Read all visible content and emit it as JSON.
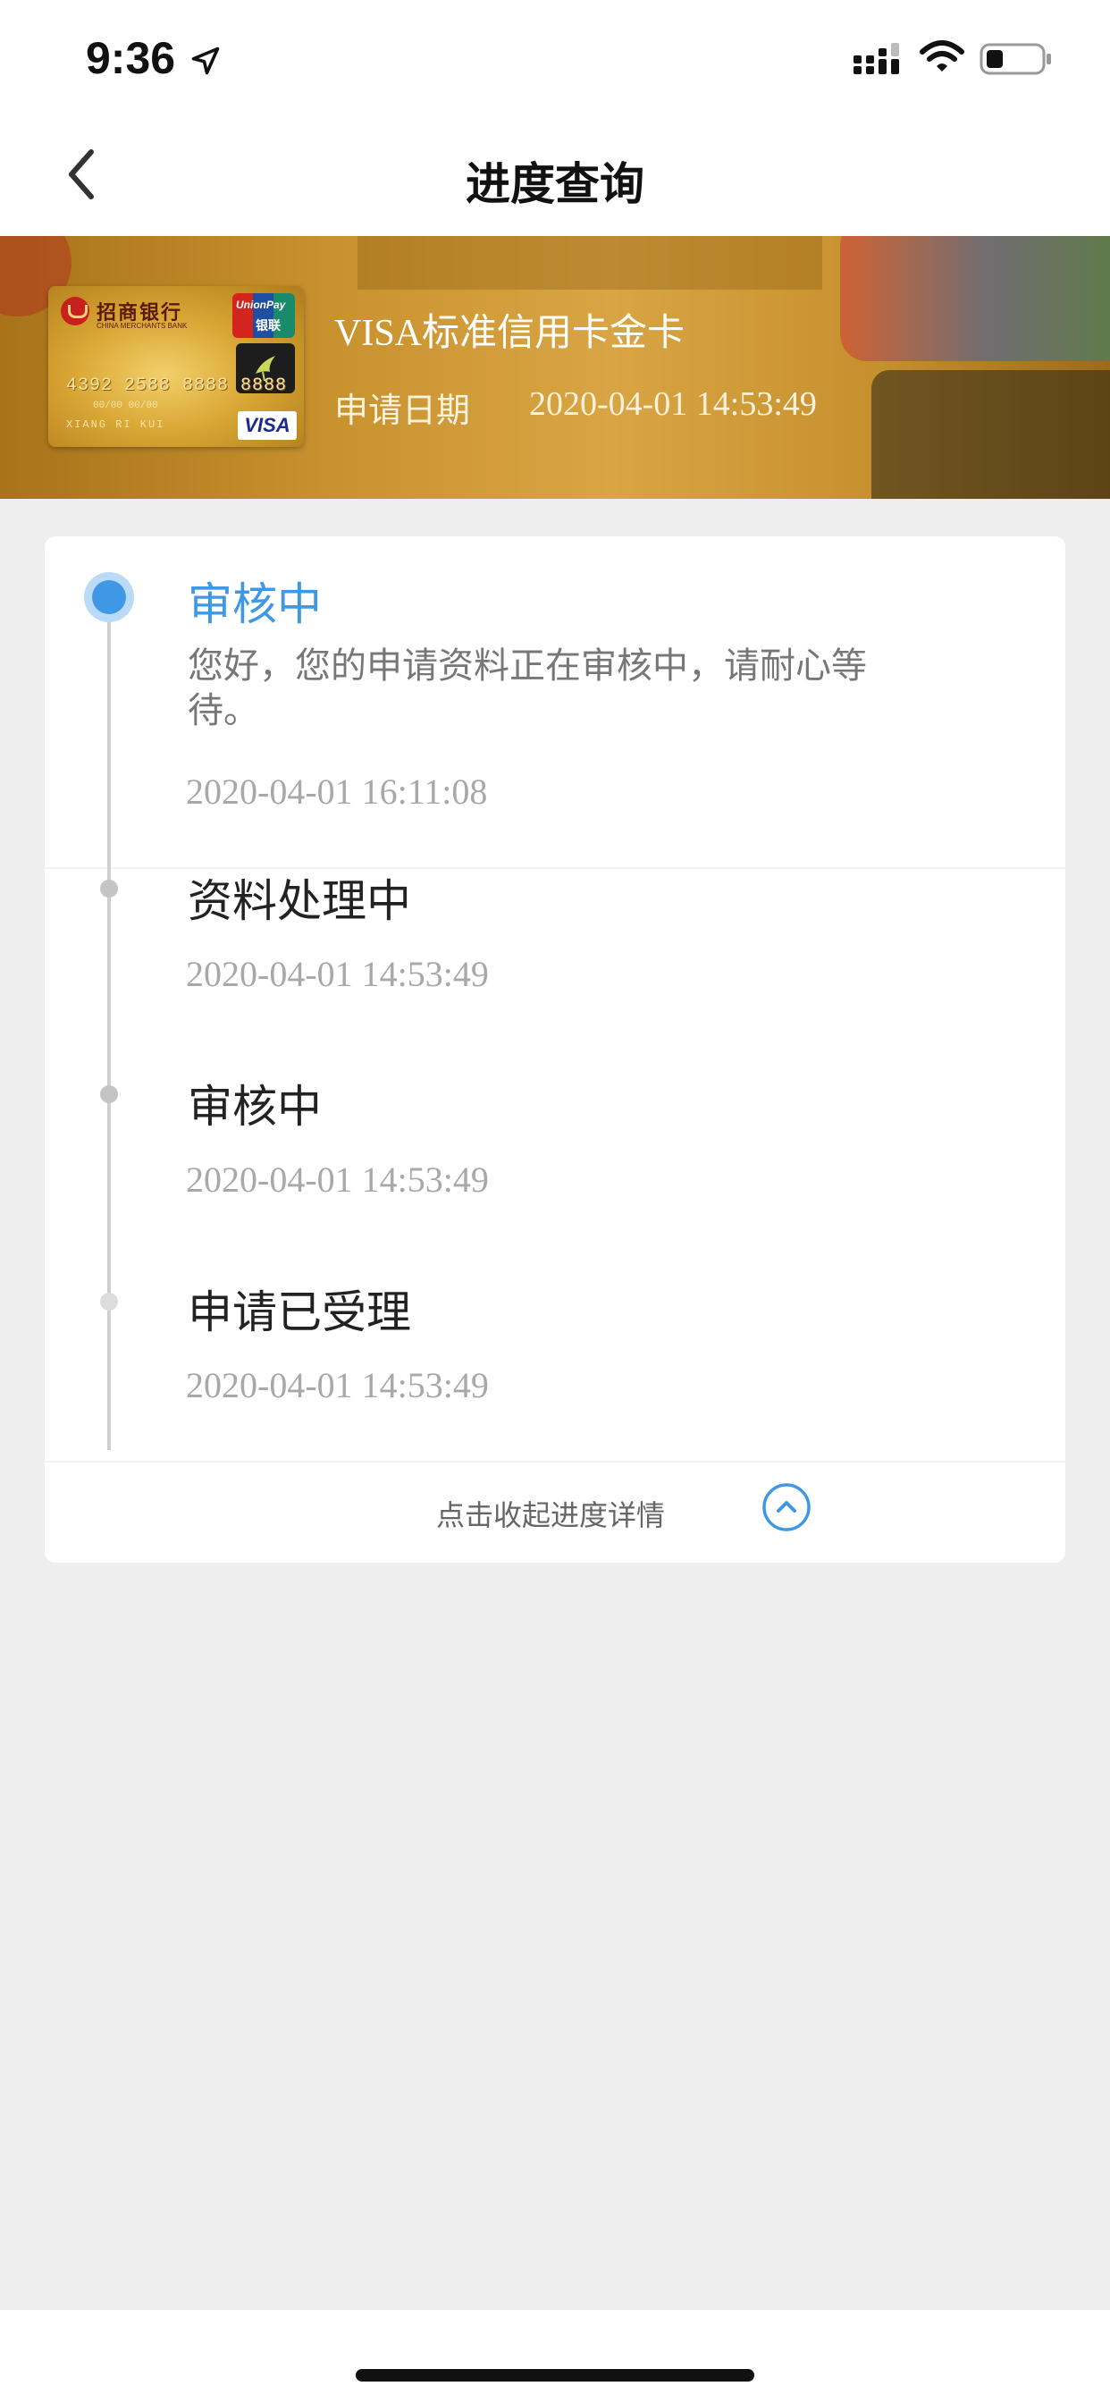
{
  "status_bar": {
    "time": "9:36",
    "icons": [
      "location-arrow-icon",
      "signal-icon",
      "wifi-icon",
      "battery-icon"
    ]
  },
  "nav": {
    "title": "进度查询",
    "back_icon": "chevron-left-icon"
  },
  "card": {
    "bank_name": "招商银行",
    "bank_name_en": "CHINA MERCHANTS BANK",
    "network_brand": "UnionPay",
    "network_brand_cn": "银联",
    "number": "4392 2588 8888 8888",
    "valid_thru": "00/00    00/00",
    "holder": "XIANG RI KUI",
    "visa_logo": "VISA",
    "product_name": "VISA标准信用卡金卡",
    "apply_date_label": "申请日期",
    "apply_date": "2020-04-01 14:53:49"
  },
  "timeline": {
    "steps": [
      {
        "title": "审核中",
        "description": "您好，您的申请资料正在审核中，请耐心等待。",
        "time": "2020-04-01 16:11:08",
        "active": true
      },
      {
        "title": "资料处理中",
        "time": "2020-04-01 14:53:49",
        "active": false
      },
      {
        "title": "审核中",
        "time": "2020-04-01 14:53:49",
        "active": false
      },
      {
        "title": "申请已受理",
        "time": "2020-04-01 14:53:49",
        "active": false
      }
    ],
    "collapse_label": "点击收起进度详情",
    "collapse_icon": "chevron-up-circle-icon"
  },
  "colors": {
    "accent": "#3f98e6",
    "background": "#eeeeee",
    "card_gold": "#d9a544"
  }
}
